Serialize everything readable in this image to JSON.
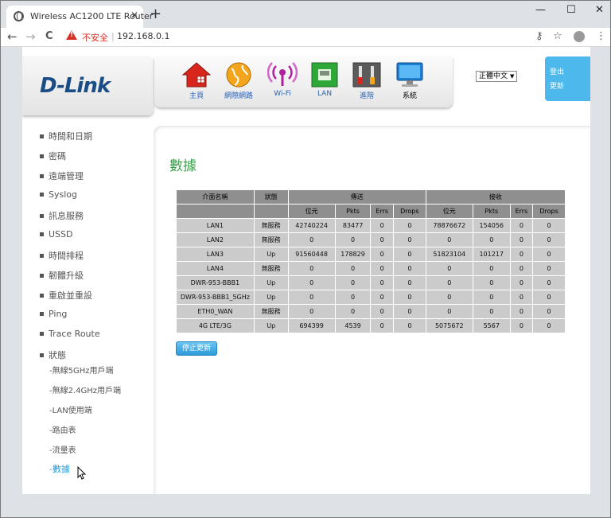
{
  "browser": {
    "tab_title": "Wireless AC1200 LTE Router",
    "tab_close": "✕",
    "new_tab": "+",
    "min": "—",
    "max": "☐",
    "close": "✕",
    "back": "←",
    "forward": "→",
    "reload": "C",
    "insecure": "不安全",
    "url_sep": "|",
    "url": "192.168.0.1",
    "key_icon": "⚷",
    "star_icon": "☆",
    "menu_icon": "⋮"
  },
  "header": {
    "logo": "D-Link",
    "nav": [
      {
        "label": "主頁",
        "icon": "home-icon"
      },
      {
        "label": "網際網路",
        "icon": "globe-icon"
      },
      {
        "label": "Wi-Fi",
        "icon": "wifi-icon"
      },
      {
        "label": "LAN",
        "icon": "lan-icon"
      },
      {
        "label": "進階",
        "icon": "tools-icon"
      },
      {
        "label": "系統",
        "icon": "monitor-icon"
      }
    ],
    "language": "正體中文",
    "logout": "登出",
    "refresh": "更新"
  },
  "sidebar": {
    "items": [
      "時間和日期",
      "密碼",
      "遠端管理",
      "Syslog",
      "訊息服務",
      "USSD",
      "時間排程",
      "韌體升級",
      "重啟並重設",
      "Ping",
      "Trace Route",
      "狀態"
    ],
    "subitems": [
      "-無線5GHz用戶端",
      "-無線2.4GHz用戶端",
      "-LAN使用端",
      "-路由表",
      "-流量表",
      "-數據"
    ]
  },
  "main": {
    "title": "數據",
    "table": {
      "header_top": [
        "介面名稱",
        "狀態",
        "傳送",
        "接收"
      ],
      "header_sub": [
        "位元",
        "Pkts",
        "Errs",
        "Drops",
        "位元",
        "Pkts",
        "Errs",
        "Drops"
      ],
      "rows": [
        [
          "LAN1",
          "無服務",
          "42740224",
          "83477",
          "0",
          "0",
          "78876672",
          "154056",
          "0",
          "0"
        ],
        [
          "LAN2",
          "無服務",
          "0",
          "0",
          "0",
          "0",
          "0",
          "0",
          "0",
          "0"
        ],
        [
          "LAN3",
          "Up",
          "91560448",
          "178829",
          "0",
          "0",
          "51823104",
          "101217",
          "0",
          "0"
        ],
        [
          "LAN4",
          "無服務",
          "0",
          "0",
          "0",
          "0",
          "0",
          "0",
          "0",
          "0"
        ],
        [
          "DWR-953-BBB1",
          "Up",
          "0",
          "0",
          "0",
          "0",
          "0",
          "0",
          "0",
          "0"
        ],
        [
          "DWR-953-BBB1_5GHz",
          "Up",
          "0",
          "0",
          "0",
          "0",
          "0",
          "0",
          "0",
          "0"
        ],
        [
          "ETH0_WAN",
          "無服務",
          "0",
          "0",
          "0",
          "0",
          "0",
          "0",
          "0",
          "0"
        ],
        [
          "4G LTE/3G",
          "Up",
          "694399",
          "4539",
          "0",
          "0",
          "5075672",
          "5567",
          "0",
          "0"
        ]
      ]
    },
    "stop_button": "停止更新"
  }
}
